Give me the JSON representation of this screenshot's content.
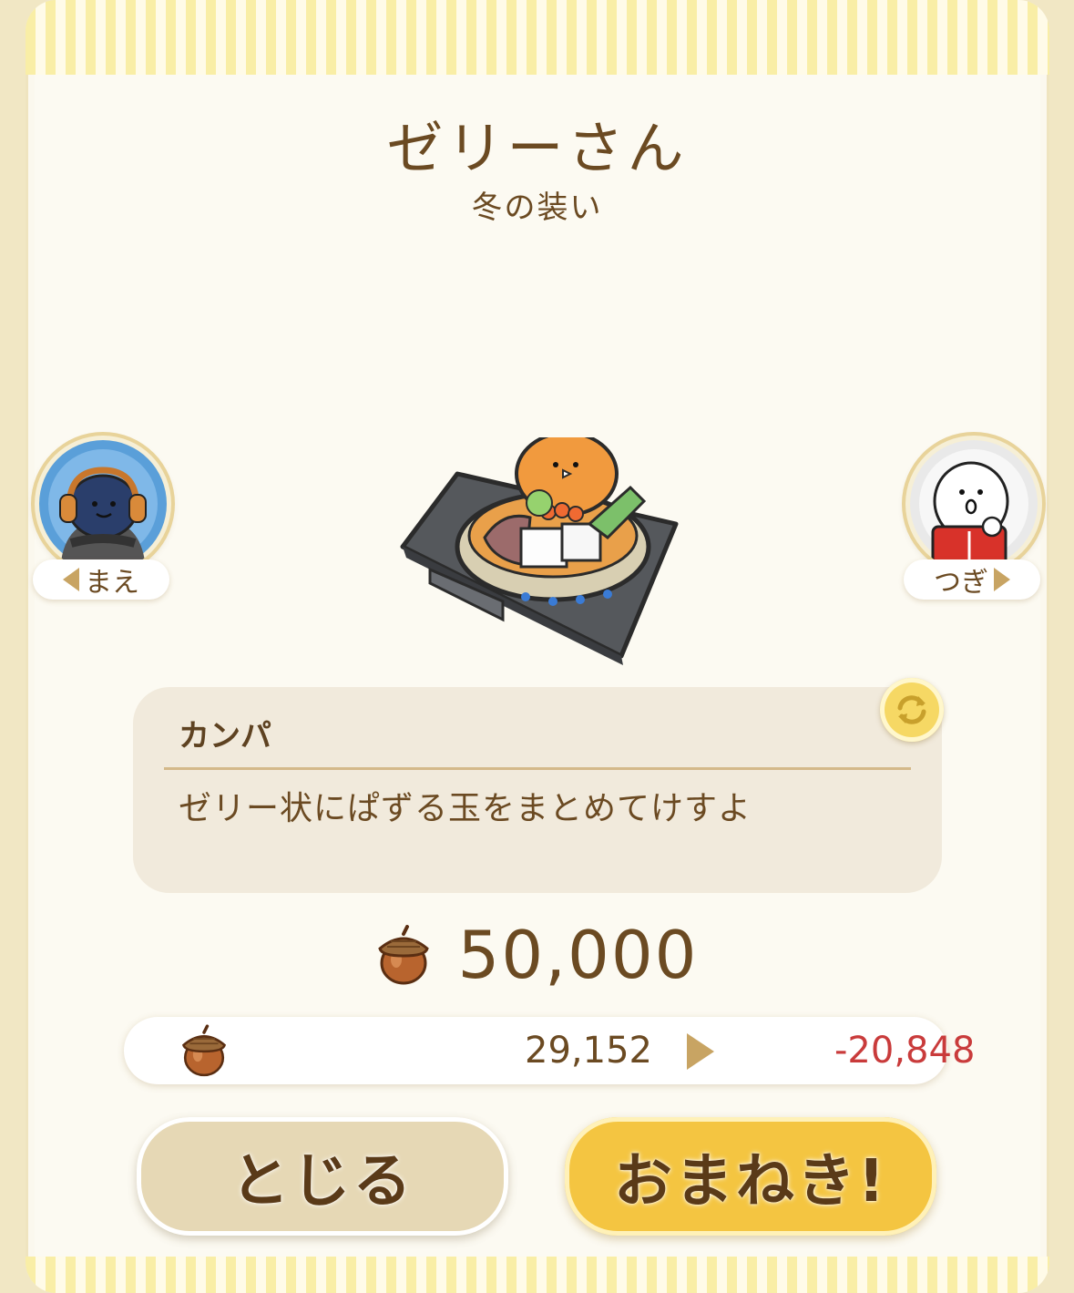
{
  "header": {
    "title": "ゼリーさん",
    "subtitle": "冬の装い"
  },
  "nav": {
    "prev_label": "まえ",
    "next_label": "つぎ"
  },
  "message": {
    "author": "カンパ",
    "text": "ゼリー状にぱずる玉をまとめてけすよ"
  },
  "price": {
    "value": "50,000"
  },
  "balance": {
    "current": "29,152",
    "after": "-20,848"
  },
  "buttons": {
    "close": "とじる",
    "invite": "おまねき!"
  },
  "colors": {
    "accent_gold": "#f4c541",
    "text_brown": "#6b4a22",
    "negative_red": "#c93b3b"
  },
  "icons": [
    "acorn-icon",
    "refresh-icon",
    "arrow-left-icon",
    "arrow-right-icon",
    "hotpot-item-image"
  ]
}
